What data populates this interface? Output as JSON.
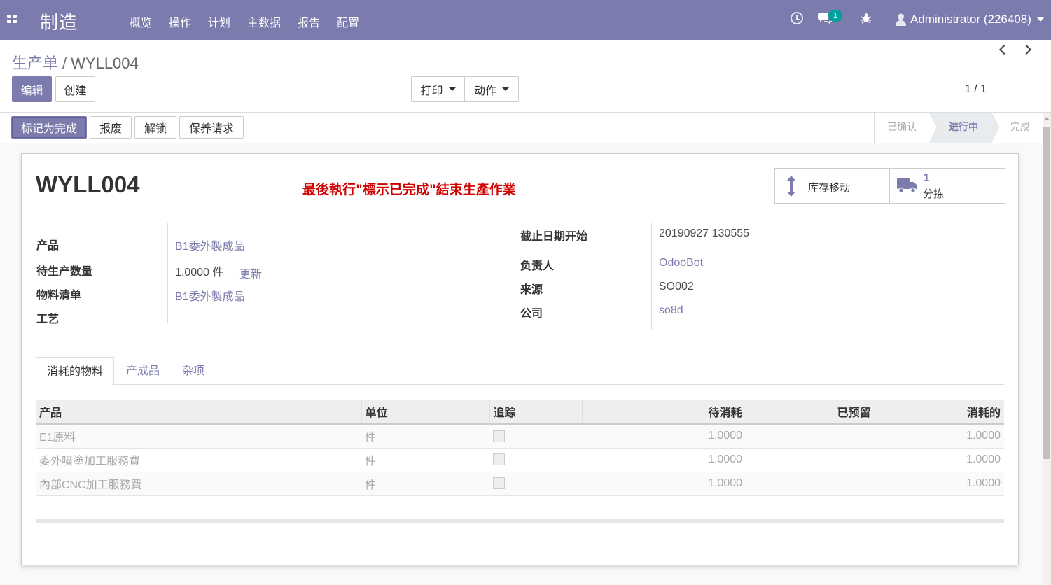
{
  "navbar": {
    "brand": "制造",
    "menu": [
      "概览",
      "操作",
      "计划",
      "主数据",
      "报告",
      "配置"
    ],
    "chat_count": "1",
    "user": "Administrator (226408)"
  },
  "breadcrumb": {
    "parent": "生产单",
    "separator": "/",
    "current": "WYLL004"
  },
  "toolbar": {
    "edit": "编辑",
    "create": "创建",
    "print": "打印",
    "action": "动作",
    "pager": "1 / 1"
  },
  "statusbar": {
    "buttons": [
      "标记为完成",
      "报废",
      "解锁",
      "保养请求"
    ],
    "stages": [
      {
        "label": "已确认",
        "active": false
      },
      {
        "label": "进行中",
        "active": true
      },
      {
        "label": "完成",
        "active": false
      }
    ]
  },
  "sheet": {
    "title": "WYLL004",
    "note": "最後執行\"標示已完成\"結束生產作業",
    "stat_moves_label": "库存移动",
    "stat_pick_value": "1",
    "stat_pick_label": "分拣",
    "left_fields": {
      "product_label": "产品",
      "product_value": "B1委外製成品",
      "qty_label": "待生产数量",
      "qty_value": "1.0000",
      "qty_uom": "件",
      "qty_update": "更新",
      "bom_label": "物料清单",
      "bom_value": "B1委外製成品",
      "routing_label": "工艺"
    },
    "right_fields": {
      "deadline_label": "截止日期开始",
      "deadline_value": "20190927 130555",
      "responsible_label": "负责人",
      "responsible_value": "OdooBot",
      "source_label": "来源",
      "source_value": "SO002",
      "company_label": "公司",
      "company_value": "so8d"
    },
    "tabs": [
      "消耗的物料",
      "产成品",
      "杂项"
    ],
    "table": {
      "headers": [
        "产品",
        "单位",
        "追踪",
        "待消耗",
        "已预留",
        "消耗的"
      ],
      "rows": [
        {
          "product": "E1原料",
          "uom": "件",
          "to_consume": "1.0000",
          "reserved": "",
          "consumed": "1.0000"
        },
        {
          "product": "委外噴塗加工服務費",
          "uom": "件",
          "to_consume": "1.0000",
          "reserved": "",
          "consumed": "1.0000"
        },
        {
          "product": "內部CNC加工服務費",
          "uom": "件",
          "to_consume": "1.0000",
          "reserved": "",
          "consumed": "1.0000"
        }
      ]
    }
  },
  "colors": {
    "brand": "#7c7bad",
    "note": "#d00000",
    "badge": "#00a09d"
  }
}
